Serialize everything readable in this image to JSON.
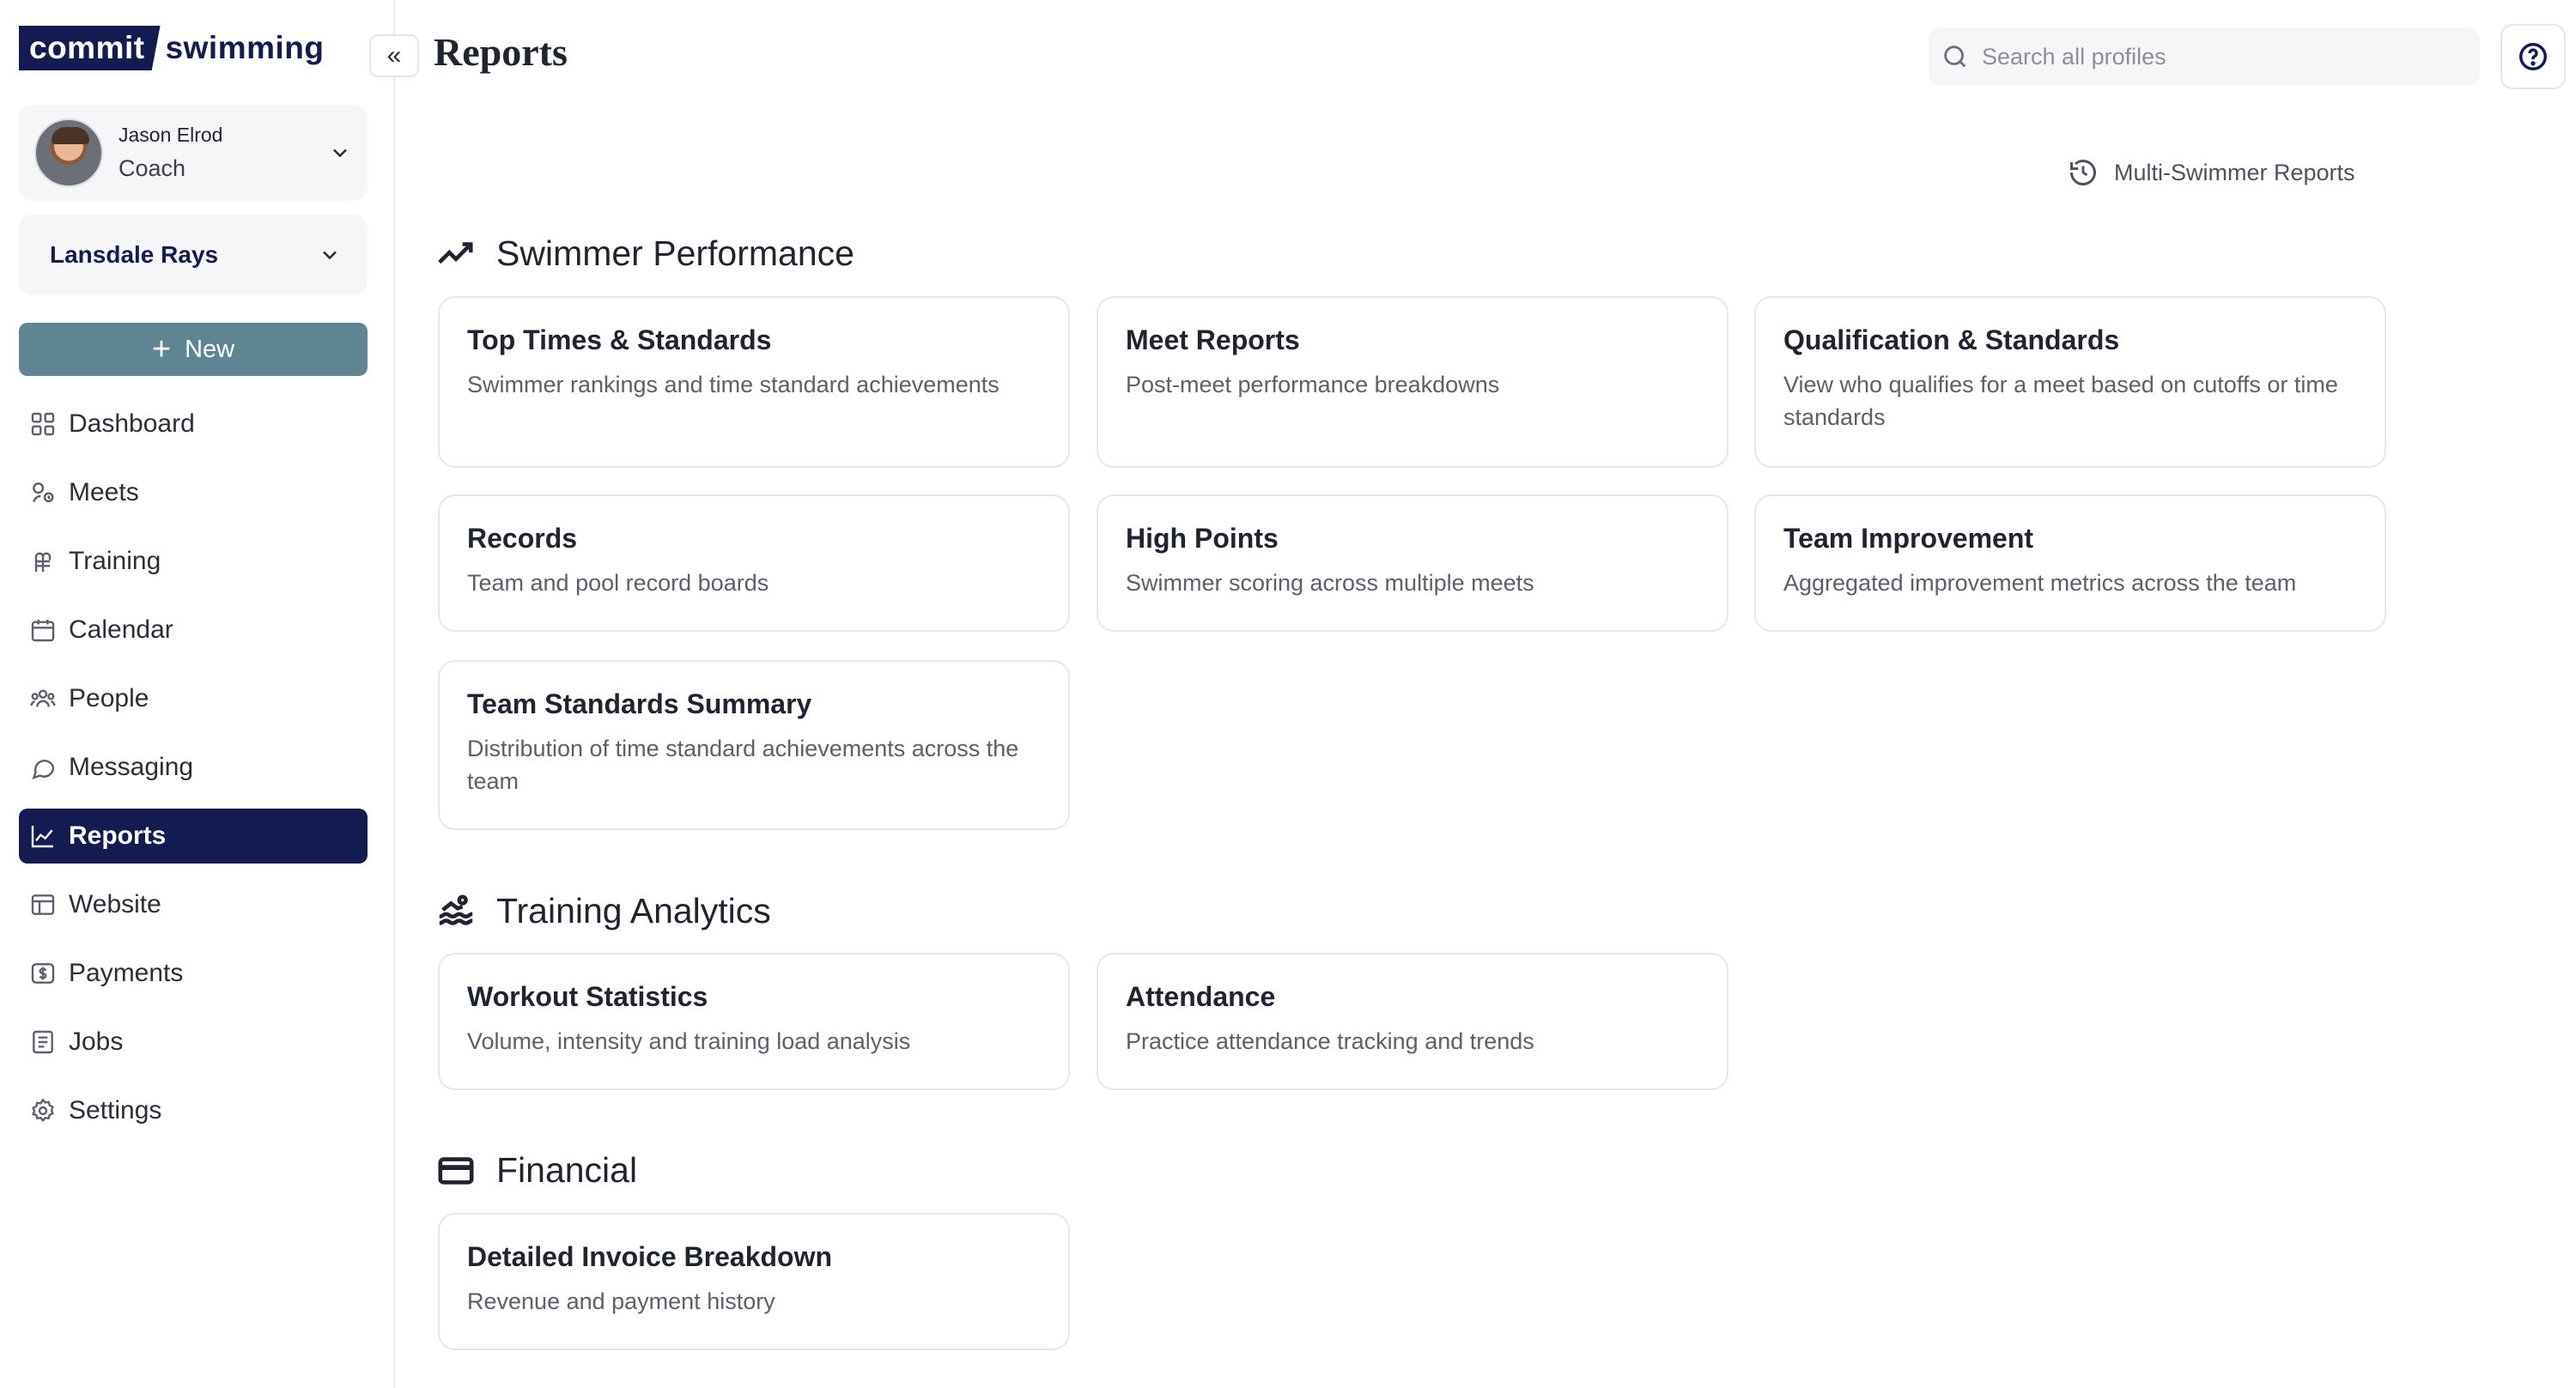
{
  "brand": {
    "logo_box": "commit",
    "logo_text": "swimming"
  },
  "user": {
    "name": "Jason Elrod",
    "role": "Coach"
  },
  "team": {
    "name": "Lansdale Rays"
  },
  "new_button": {
    "label": "New"
  },
  "nav": [
    {
      "label": "Dashboard",
      "icon": "grid-icon"
    },
    {
      "label": "Meets",
      "icon": "meets-icon"
    },
    {
      "label": "Training",
      "icon": "training-icon"
    },
    {
      "label": "Calendar",
      "icon": "calendar-icon"
    },
    {
      "label": "People",
      "icon": "people-icon"
    },
    {
      "label": "Messaging",
      "icon": "message-icon"
    },
    {
      "label": "Reports",
      "icon": "chart-icon",
      "active": true
    },
    {
      "label": "Website",
      "icon": "website-icon"
    },
    {
      "label": "Payments",
      "icon": "dollar-icon"
    },
    {
      "label": "Jobs",
      "icon": "document-icon"
    },
    {
      "label": "Settings",
      "icon": "gear-icon"
    }
  ],
  "header": {
    "collapse_glyph": "«",
    "title": "Reports",
    "search_placeholder": "Search all profiles"
  },
  "multi_swimmer_link": "Multi-Swimmer Reports",
  "sections": {
    "swimmer_performance": {
      "title": "Swimmer Performance",
      "cards": [
        {
          "title": "Top Times & Standards",
          "desc": "Swimmer rankings and time standard achievements"
        },
        {
          "title": "Meet Reports",
          "desc": "Post-meet performance breakdowns"
        },
        {
          "title": "Qualification & Standards",
          "desc": "View who qualifies for a meet based on cutoffs or time standards"
        },
        {
          "title": "Records",
          "desc": "Team and pool record boards"
        },
        {
          "title": "High Points",
          "desc": "Swimmer scoring across multiple meets"
        },
        {
          "title": "Team Improvement",
          "desc": "Aggregated improvement metrics across the team"
        },
        {
          "title": "Team Standards Summary",
          "desc": "Distribution of time standard achievements across the team"
        }
      ]
    },
    "training_analytics": {
      "title": "Training Analytics",
      "cards": [
        {
          "title": "Workout Statistics",
          "desc": "Volume, intensity and training load analysis"
        },
        {
          "title": "Attendance",
          "desc": "Practice attendance tracking and trends"
        }
      ]
    },
    "financial": {
      "title": "Financial",
      "cards": [
        {
          "title": "Detailed Invoice Breakdown",
          "desc": "Revenue and payment history"
        }
      ]
    }
  },
  "colors": {
    "brand_navy": "#141a52",
    "new_button": "#5f8593",
    "card_border": "#e6e7eb"
  }
}
